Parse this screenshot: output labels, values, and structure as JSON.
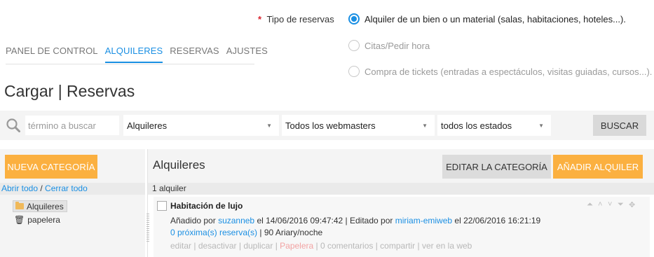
{
  "reservation_type": {
    "label": "Tipo de reservas",
    "required_mark": "*",
    "options": [
      {
        "label": "Alquiler de un bien o un material (salas, habitaciones, hoteles...).",
        "selected": true
      },
      {
        "label": "Citas/Pedir hora",
        "selected": false
      },
      {
        "label": "Compra de tickets (entradas a espectáculos, visitas guiadas, cursos...).",
        "selected": false
      }
    ]
  },
  "nav": {
    "tabs": [
      {
        "label": "PANEL DE CONTROL",
        "active": false
      },
      {
        "label": "ALQUILERES",
        "active": true
      },
      {
        "label": "RESERVAS",
        "active": false
      },
      {
        "label": "AJUSTES",
        "active": false
      }
    ]
  },
  "page_title": "Cargar | Reservas",
  "search": {
    "placeholder": "término a buscar",
    "filter_type": "Alquileres",
    "filter_webmaster": "Todos los webmasters",
    "filter_status": "todos los estados",
    "button_label": "BUSCAR"
  },
  "sidebar": {
    "new_category_label": "NUEVA CATEGORÍA",
    "open_all_label": "Abrir todo",
    "separator": " / ",
    "close_all_label": "Cerrar todo",
    "tree": [
      {
        "label": "Alquileres",
        "icon": "folder-icon",
        "selected": true
      },
      {
        "label": "papelera",
        "icon": "trash-icon",
        "selected": false
      }
    ]
  },
  "main": {
    "title": "Alquileres",
    "edit_category_label": "EDITAR LA CATEGORÍA",
    "add_rental_label": "AÑADIR ALQUILER",
    "count_text": "1 alquiler",
    "items": [
      {
        "title": "Habitación de lujo",
        "added_prefix": "Añadido por ",
        "added_by": "suzanneb",
        "added_on": " el 14/06/2016 09:47:42 | Editado por ",
        "edited_by": "miriam-emiweb",
        "edited_on": " el 22/06/2016 16:21:19",
        "upcoming_link": "0 próxima(s) reserva(s)",
        "price_text": " | 90 Ariary/noche",
        "actions": {
          "edit": "editar",
          "deactivate": "desactivar",
          "duplicate": "duplicar",
          "trash": "Papelera",
          "comments": "0 comentarios",
          "share": "compartir",
          "view": "ver en la web",
          "separator": " | "
        }
      }
    ]
  },
  "colors": {
    "accent_blue": "#1a8fe3",
    "orange_button": "#fbb040",
    "required_red": "#d9232e"
  }
}
